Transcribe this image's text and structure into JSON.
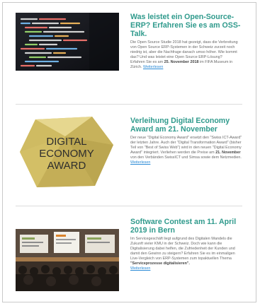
{
  "articles": [
    {
      "title": "Was leistet ein Open-Source-ERP? Erfahren Sie es am OSS-Talk.",
      "paragraph": "Die Open Source Studie 2018 hat gezeigt, dass die Verbreitung von Open Source ERP-Systemen in der Schweiz zurzeit noch niedrig ist, aber die Nachfrage danach umso höher. Wie kommt das? Und was leistet eine Open Source ERP-Lösung?",
      "event_prefix": "Erfahren Sie es am",
      "event_date": "25. November 2018",
      "event_suffix": "im FIFA Museum in Zürich.",
      "read_more": "Weiterlesen",
      "image_icon": "code-screen-photo"
    },
    {
      "title": "Verleihung Digital Economy Award am 21. November",
      "paragraph": "Der neue \"Digital Economy Award\" ersetzt den \"Swiss ICT-Award\" der letzten Jahre. Auch der \"Digital Transformation Award\" (bisher Teil von \"Best of Swiss Web\") wird in den neuen \"Digital Economy Award\" integriert. Verliehen werden die Preise am",
      "event_date": "21. November",
      "event_suffix": "von den Verbänden SwissICT und Simsa sowie dem Netzmedien.",
      "read_more": "Weiterlesen",
      "logo": {
        "line1": "DIGITAL",
        "line2": "ECONOMY",
        "line3": "AWARD"
      },
      "image_icon": "award-gem-logo"
    },
    {
      "title": "Software Contest am 11. April 2019 in Bern",
      "paragraph": "Im Servicegeschäft liegt aufgrund des Digitalen Wandels die Zukunft vieler KMU in der Schweiz. Doch wie kann die Digitalisierung dabei helfen, die Zufriedenheit der Kunden und damit den Gewinn zu steigern? Erfahren Sie es im einmaligen Live-Vergleich von ERP-Systemen zum topaktuellen Thema",
      "event_date": "\"Serviceprozesse digitalisieren\".",
      "read_more": "Weiterlesen",
      "image_icon": "conference-photo"
    }
  ],
  "colors": {
    "title": "#2f9a8c",
    "link": "#2a8ad6",
    "text": "#6a6a6a"
  }
}
